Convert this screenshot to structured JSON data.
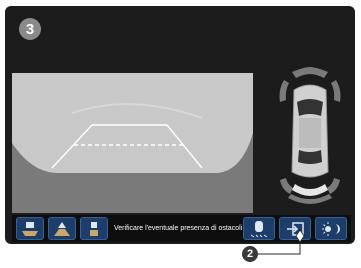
{
  "step_number": "3",
  "callout_number": "2",
  "camera": {
    "guide_color": "#ffffff",
    "background_color": "#b9b9b9"
  },
  "bottom_bar": {
    "message": "Verificare l'eventuale presenza di ostacoli",
    "buttons": [
      {
        "icon": "top-view-icon"
      },
      {
        "icon": "wide-view-icon"
      },
      {
        "icon": "normal-view-icon"
      },
      {
        "icon": "parking-sensor-toggle-icon"
      },
      {
        "icon": "exit-icon"
      },
      {
        "icon": "brightness-icon"
      }
    ]
  },
  "colors": {
    "button_blue": "#1d3d6b",
    "sensor_gray": "#7a7a7a",
    "sensor_light": "#e6e6e6"
  }
}
